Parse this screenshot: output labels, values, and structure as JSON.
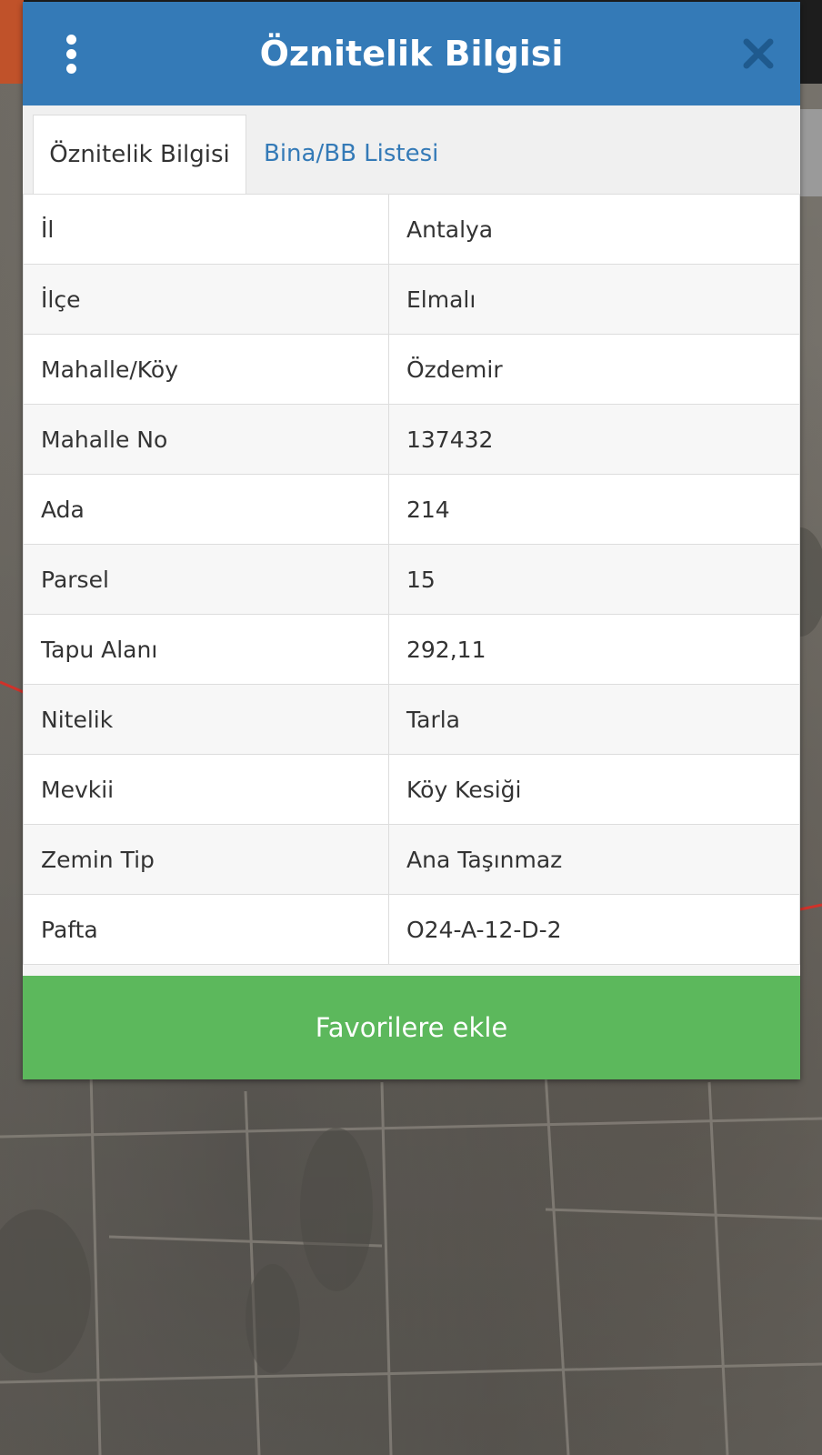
{
  "dialog": {
    "title": "Öznitelik Bilgisi",
    "menu_icon": "more-vertical-icon",
    "close_icon": "close-icon"
  },
  "tabs": [
    {
      "label": "Öznitelik Bilgisi",
      "active": true
    },
    {
      "label": "Bina/BB Listesi",
      "active": false
    }
  ],
  "attributes": [
    {
      "label": "İl",
      "value": "Antalya"
    },
    {
      "label": "İlçe",
      "value": "Elmalı"
    },
    {
      "label": "Mahalle/Köy",
      "value": "Özdemir"
    },
    {
      "label": "Mahalle No",
      "value": "137432"
    },
    {
      "label": "Ada",
      "value": "214"
    },
    {
      "label": "Parsel",
      "value": "15"
    },
    {
      "label": "Tapu Alanı",
      "value": "292,11"
    },
    {
      "label": "Nitelik",
      "value": "Tarla"
    },
    {
      "label": "Mevkii",
      "value": "Köy Kesiği"
    },
    {
      "label": "Zemin Tip",
      "value": "Ana Taşınmaz"
    },
    {
      "label": "Pafta",
      "value": "O24-A-12-D-2"
    }
  ],
  "actions": {
    "favorite_label": "Favorilere ekle"
  },
  "colors": {
    "header": "#347ab7",
    "link": "#347ab7",
    "favorite_button": "#5cb85c"
  }
}
